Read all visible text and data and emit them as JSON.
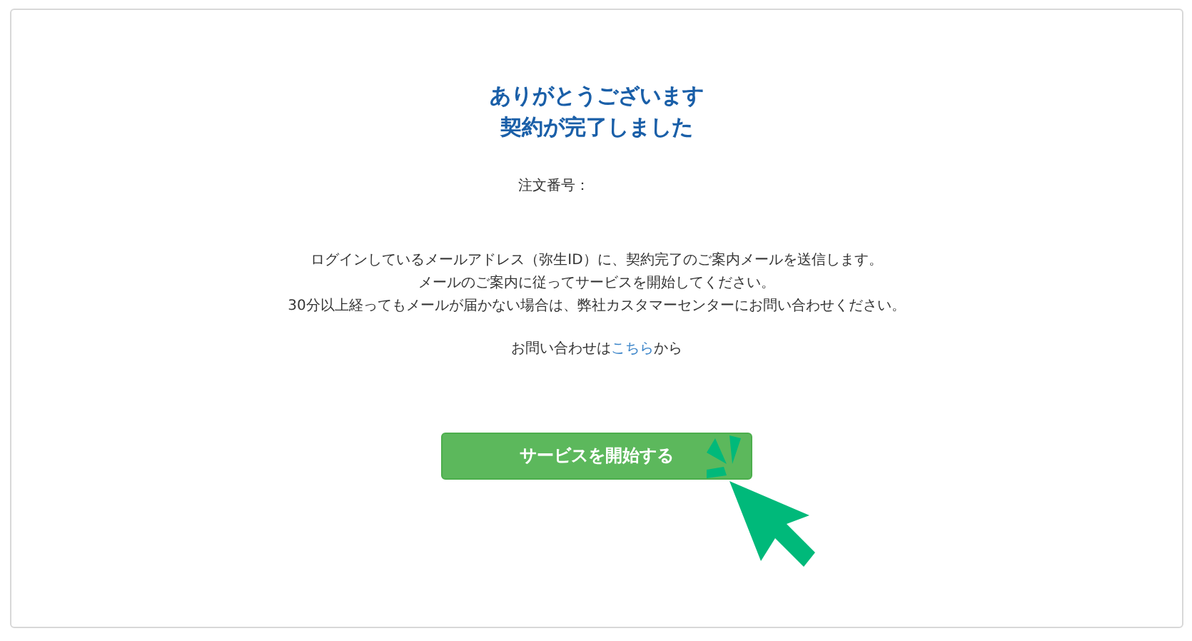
{
  "title_lines": [
    "ありがとうございます",
    "契約が完了しました"
  ],
  "order_number": {
    "label": "注文番号："
  },
  "message_lines": [
    "ログインしているメールアドレス（弥生ID）に、契約完了のご案内メールを送信します。",
    "メールのご案内に従ってサービスを開始してください。",
    "30分以上経ってもメールが届かない場合は、弊社カスタマーセンターにお問い合わせください。"
  ],
  "contact": {
    "before": "お問い合わせは",
    "link": "こちら",
    "after": "から"
  },
  "start_button": {
    "label": "サービスを開始する"
  }
}
